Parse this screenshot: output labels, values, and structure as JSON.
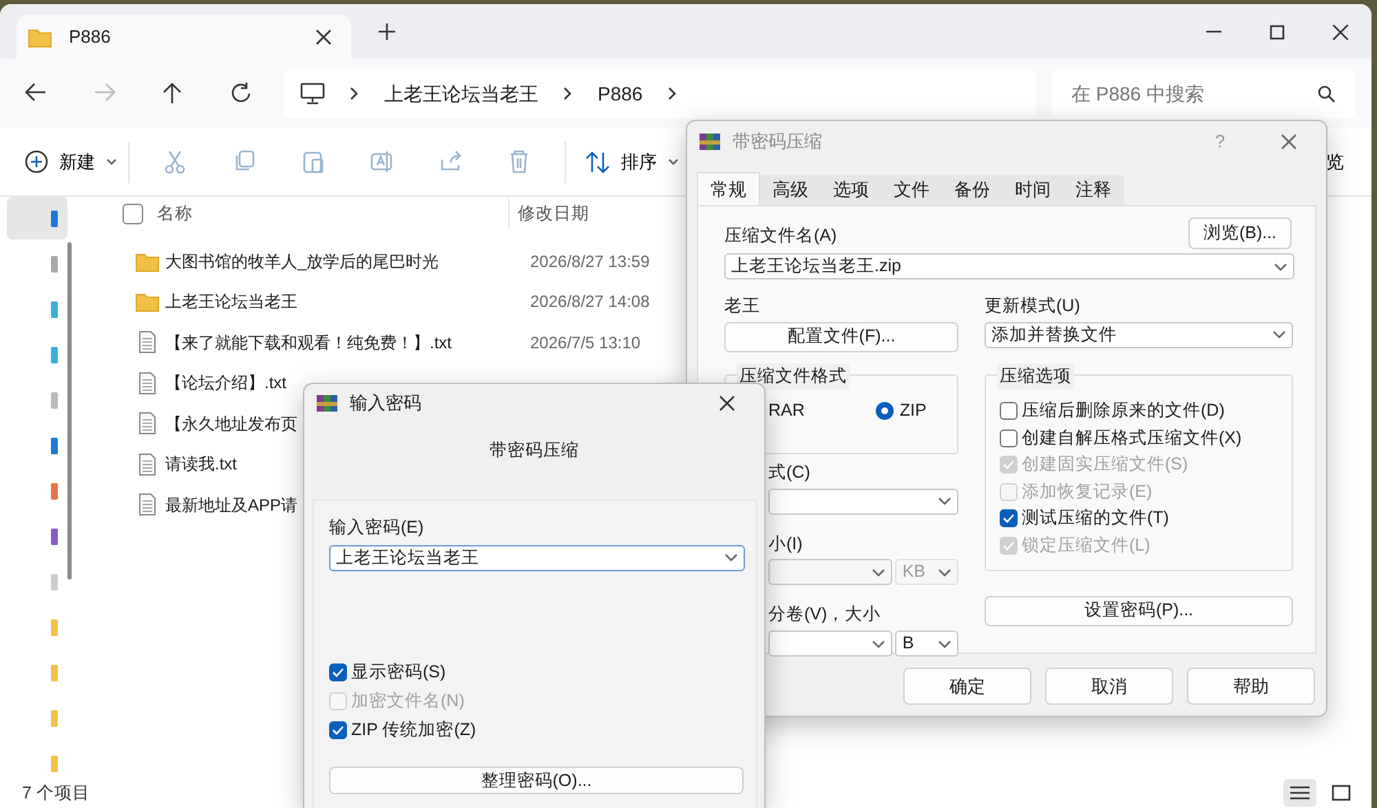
{
  "explorer": {
    "tab": {
      "title": "P886"
    },
    "breadcrumb": [
      "上老王论坛当老王",
      "P886"
    ],
    "search": {
      "placeholder": "在 P886 中搜索"
    },
    "toolbar": {
      "new_label": "新建",
      "sort_label": "排序",
      "view_label": "览"
    },
    "select_all_checked": false,
    "columns": [
      "名称",
      "修改日期"
    ],
    "files": [
      {
        "kind": "folder",
        "name": "大图书馆的牧羊人_放学后的尾巴时光",
        "date": "2026/8/27 13:59"
      },
      {
        "kind": "folder",
        "name": "上老王论坛当老王",
        "date": "2026/8/27 14:08"
      },
      {
        "kind": "text",
        "name": "【来了就能下载和观看！纯免费！】.txt",
        "date": "2026/7/5 13:10"
      },
      {
        "kind": "text",
        "name": "【论坛介绍】.txt"
      },
      {
        "kind": "text",
        "name": "【永久地址发布页"
      },
      {
        "kind": "text",
        "name": "请读我.txt"
      },
      {
        "kind": "text",
        "name": "最新地址及APP请"
      }
    ],
    "status": "7 个项目"
  },
  "archive_dialog": {
    "title": "带密码压缩",
    "help": "?",
    "tabs": [
      {
        "label": "常规",
        "selected": true
      },
      {
        "label": "高级",
        "selected": false
      },
      {
        "label": "选项",
        "selected": false
      },
      {
        "label": "文件",
        "selected": false
      },
      {
        "label": "备份",
        "selected": false
      },
      {
        "label": "时间",
        "selected": false
      },
      {
        "label": "注释",
        "selected": false
      }
    ],
    "archive_name_label": "压缩文件名(A)",
    "browse_button": "浏览(B)...",
    "archive_name": "上老王论坛当老王.zip",
    "profile_label": "老王",
    "profile_button": "配置文件(F)...",
    "update_mode_label": "更新模式(U)",
    "update_mode": "添加并替换文件",
    "format_group": "压缩文件格式",
    "formats": [
      {
        "label": "RAR",
        "selected": false
      },
      {
        "label": "ZIP",
        "selected": true
      }
    ],
    "method_label": "式(C)",
    "dictionary_label": "小(I)",
    "dictionary_unit": "KB",
    "volume_label": "分卷(V)，大小",
    "volume_unit": "B",
    "options_group": "压缩选项",
    "options": [
      {
        "label": "压缩后删除原来的文件(D)",
        "checked": false,
        "disabled": false
      },
      {
        "label": "创建自解压格式压缩文件(X)",
        "checked": false,
        "disabled": false
      },
      {
        "label": "创建固实压缩文件(S)",
        "checked": true,
        "disabled": true
      },
      {
        "label": "添加恢复记录(E)",
        "checked": false,
        "disabled": true
      },
      {
        "label": "测试压缩的文件(T)",
        "checked": true,
        "disabled": false
      },
      {
        "label": "锁定压缩文件(L)",
        "checked": true,
        "disabled": true
      }
    ],
    "password_button": "设置密码(P)...",
    "buttons": [
      "确定",
      "取消",
      "帮助"
    ]
  },
  "password_dialog": {
    "title": "输入密码",
    "subtitle": "带密码压缩",
    "password_label": "输入密码(E)",
    "password": "上老王论坛当老王",
    "options": [
      {
        "label": "显示密码(S)",
        "checked": true,
        "disabled": false
      },
      {
        "label": "加密文件名(N)",
        "checked": false,
        "disabled": true
      },
      {
        "label": "ZIP 传统加密(Z)",
        "checked": true,
        "disabled": false
      }
    ],
    "organize_button": "整理密码(O)..."
  }
}
